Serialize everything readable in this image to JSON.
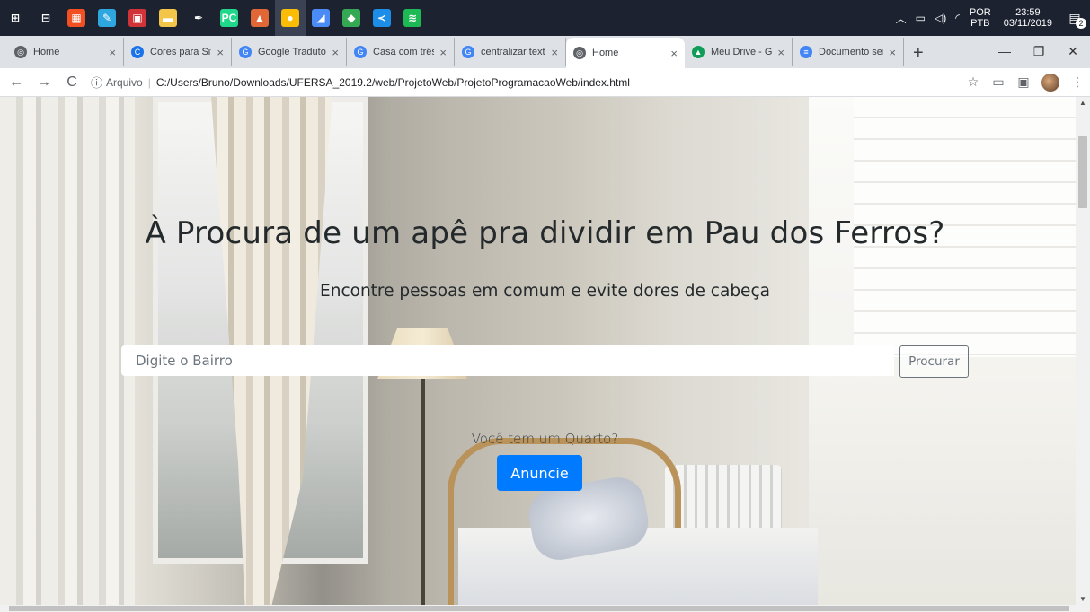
{
  "taskbar": {
    "apps": [
      {
        "icon": "windows-start-icon",
        "color": "#1c2230",
        "glyph": "⊞"
      },
      {
        "icon": "task-view-icon",
        "color": "#1c2230",
        "glyph": "⊟"
      },
      {
        "icon": "app-colorful-icon",
        "color": "#f25022",
        "glyph": "▦"
      },
      {
        "icon": "editor-icon",
        "color": "#2ea7e0",
        "glyph": "✎"
      },
      {
        "icon": "photo-app-icon",
        "color": "#d13438",
        "glyph": "▣"
      },
      {
        "icon": "file-explorer-icon",
        "color": "#f3c64a",
        "glyph": "▬"
      },
      {
        "icon": "pen-app-icon",
        "color": "#1c2230",
        "glyph": "✒"
      },
      {
        "icon": "pycharm-icon",
        "color": "#21d789",
        "glyph": "PC"
      },
      {
        "icon": "matlab-icon",
        "color": "#e16737",
        "glyph": "▲"
      },
      {
        "icon": "chrome-icon",
        "color": "#fbbc05",
        "glyph": "●"
      },
      {
        "icon": "notes-app-icon",
        "color": "#4b8bf5",
        "glyph": "◢"
      },
      {
        "icon": "green-app-icon",
        "color": "#34a853",
        "glyph": "◆"
      },
      {
        "icon": "vscode-icon",
        "color": "#1c8ee8",
        "glyph": "≺"
      },
      {
        "icon": "spotify-icon",
        "color": "#1db954",
        "glyph": "≋"
      }
    ],
    "tray": {
      "lang_top": "POR",
      "lang_bottom": "PTB",
      "time": "23:59",
      "date": "03/11/2019",
      "notification_count": "2"
    }
  },
  "browser": {
    "tabs": [
      {
        "title": "Home",
        "favicon_color": "#5f6368",
        "favicon_glyph": "◎",
        "active": false,
        "width": 130
      },
      {
        "title": "Cores para Site",
        "favicon_color": "#1a73e8",
        "favicon_glyph": "C",
        "active": false,
        "width": 120
      },
      {
        "title": "Google Tradutor",
        "favicon_color": "#4285f4",
        "favicon_glyph": "G",
        "active": false,
        "width": 128
      },
      {
        "title": "Casa com três",
        "favicon_color": "#4285f4",
        "favicon_glyph": "G",
        "active": false,
        "width": 120
      },
      {
        "title": "centralizar texto",
        "favicon_color": "#4285f4",
        "favicon_glyph": "G",
        "active": false,
        "width": 124
      },
      {
        "title": "Home",
        "favicon_color": "#5f6368",
        "favicon_glyph": "◎",
        "active": true,
        "width": 132
      },
      {
        "title": "Meu Drive - Google",
        "favicon_color": "#0f9d58",
        "favicon_glyph": "▲",
        "active": false,
        "width": 120
      },
      {
        "title": "Documento sem",
        "favicon_color": "#4285f4",
        "favicon_glyph": "≡",
        "active": false,
        "width": 124
      }
    ],
    "new_tab": "+",
    "address": {
      "scheme_label": "Arquivo",
      "url": "C:/Users/Bruno/Downloads/UFERSA_2019.2/web/ProjetoWeb/ProjetoProgramacaoWeb/index.html"
    }
  },
  "page": {
    "title": "À Procura de um apê pra dividir em Pau dos Ferros?",
    "subtitle": "Encontre pessoas em comum e evite dores de cabeça",
    "search": {
      "placeholder": "Digite o Bairro",
      "button_label": "Procurar"
    },
    "cta": {
      "text": "Você tem um Quarto?",
      "button_label": "Anuncie"
    }
  },
  "colors": {
    "accent": "#007bff",
    "taskbar": "#1c2230",
    "tabstrip": "#dee1e6"
  }
}
